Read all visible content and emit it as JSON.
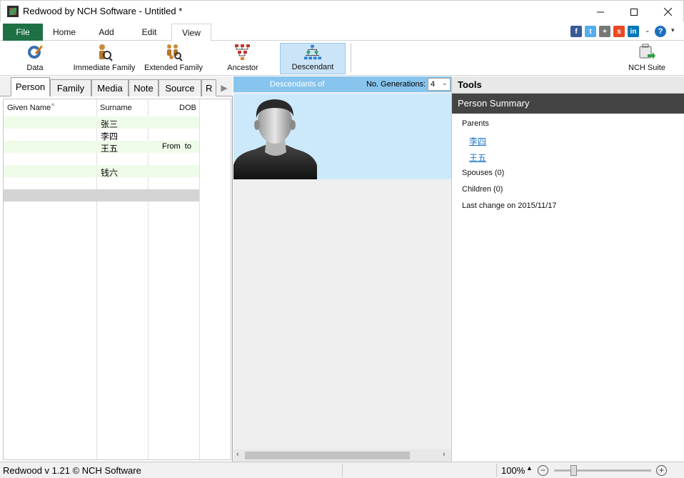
{
  "window": {
    "title": "Redwood by NCH Software - Untitled *"
  },
  "menu": {
    "tabs": [
      "File",
      "Home",
      "Add",
      "Edit",
      "View"
    ],
    "active": "View"
  },
  "toolbar": {
    "data": "Data",
    "immediate_family": "Immediate Family",
    "extended_family": "Extended Family",
    "ancestor": "Ancestor",
    "descendant": "Descendant",
    "nch_suite": "NCH Suite"
  },
  "left": {
    "tabs": [
      "Person",
      "Family",
      "Media",
      "Note",
      "Source",
      "R"
    ],
    "columns": {
      "given": "Given Name",
      "surname": "Surname",
      "dob": "DOB"
    },
    "rows": [
      {
        "given": "",
        "surname": "张三",
        "dob": ""
      },
      {
        "given": "",
        "surname": "李四",
        "dob": ""
      },
      {
        "given": "",
        "surname": "王五",
        "dob": "From  to"
      },
      {
        "given": "",
        "surname": "",
        "dob": ""
      },
      {
        "given": "",
        "surname": "钱六",
        "dob": ""
      },
      {
        "given": "",
        "surname": "",
        "dob": ""
      },
      {
        "given": "",
        "surname": "",
        "dob": ""
      }
    ]
  },
  "center": {
    "title": "Descendants of",
    "generations_label": "No. Generations:",
    "generations_value": "4"
  },
  "right": {
    "tools": "Tools",
    "summary_title": "Person Summary",
    "parents_label": "Parents",
    "parents": [
      "李四",
      "王五"
    ],
    "spouses": "Spouses (0)",
    "children": "Children (0)",
    "last_change": "Last change on 2015/11/17"
  },
  "status": {
    "version": "Redwood v 1.21 © NCH Software",
    "zoom": "100%"
  }
}
